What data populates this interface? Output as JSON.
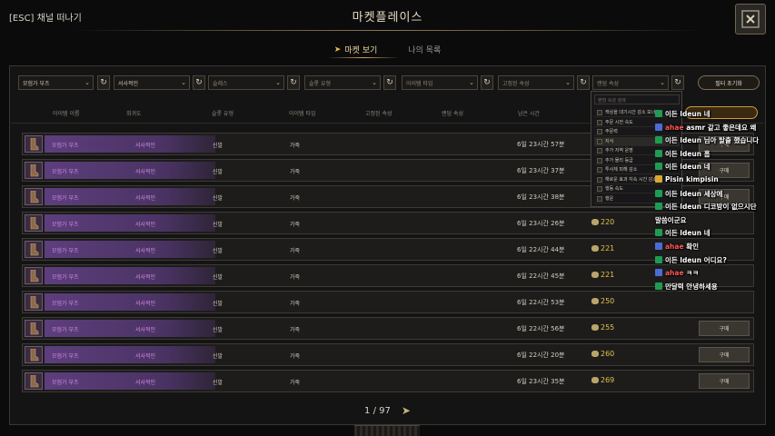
{
  "header": {
    "esc_label": "[ESC] 채널 떠나기",
    "title": "마켓플레이스"
  },
  "tabs": [
    {
      "label": "마켓 보기"
    },
    {
      "label": "나의 목록"
    }
  ],
  "filters": {
    "dropdowns": [
      "모험가 부츠",
      "서사적인",
      "슬레스",
      "슬롯 유형",
      "아이템 타입",
      "고정된 속성",
      "랜덤 속성"
    ],
    "reset_label": "필터 초기화"
  },
  "columns": [
    "아이템 이름",
    "희귀도",
    "슬롯 유형",
    "아이템 타입",
    "고정된 속성",
    "랜덤 속성",
    "남은 시간"
  ],
  "rows": [
    {
      "name": "모험가 부츠",
      "grade": "서사적인",
      "slot": "신발",
      "material": "가죽",
      "time": "6일 23시간 57분",
      "price": "",
      "buy": "구매"
    },
    {
      "name": "모험가 부츠",
      "grade": "서사적인",
      "slot": "신발",
      "material": "가죽",
      "time": "6일 23시간 37분",
      "price": "",
      "buy": "구매"
    },
    {
      "name": "모험가 부츠",
      "grade": "서사적인",
      "slot": "신발",
      "material": "가죽",
      "time": "6일 23시간 38분",
      "price": "",
      "buy": "구매"
    },
    {
      "name": "모험가 부츠",
      "grade": "서사적인",
      "slot": "신발",
      "material": "가죽",
      "time": "6일 23시간 26분",
      "price": "220",
      "buy": ""
    },
    {
      "name": "모험가 부츠",
      "grade": "서사적인",
      "slot": "신발",
      "material": "가죽",
      "time": "6일 22시간 44분",
      "price": "221",
      "buy": ""
    },
    {
      "name": "모험가 부츠",
      "grade": "서사적인",
      "slot": "신발",
      "material": "가죽",
      "time": "6일 22시간 45분",
      "price": "221",
      "buy": ""
    },
    {
      "name": "모험가 부츠",
      "grade": "서사적인",
      "slot": "신발",
      "material": "가죽",
      "time": "6일 22시간 53분",
      "price": "250",
      "buy": ""
    },
    {
      "name": "모험가 부츠",
      "grade": "서사적인",
      "slot": "신발",
      "material": "가죽",
      "time": "6일 22시간 56분",
      "price": "255",
      "buy": "구매"
    },
    {
      "name": "모험가 부츠",
      "grade": "서사적인",
      "slot": "신발",
      "material": "가죽",
      "time": "6일 22시간 20분",
      "price": "260",
      "buy": "구매"
    },
    {
      "name": "모험가 부츠",
      "grade": "서사적인",
      "slot": "신발",
      "material": "가죽",
      "time": "6일 23시간 35분",
      "price": "269",
      "buy": "구매"
    }
  ],
  "attr_popup": {
    "search_placeholder": "랜덤 속성 검색",
    "options": [
      "캐싱을 대기시간 감소 보너스",
      "주문 시전 속도",
      "주문력",
      "지식",
      "추가 지역 운명",
      "추가 물리 등급",
      "투사체 피해 감소",
      "해로운 효과 지속 시간 감소",
      "행동 속도",
      "행운"
    ]
  },
  "chat": [
    {
      "badge": "green",
      "user": "이든 ldeun",
      "msg": "네"
    },
    {
      "badge": "blue",
      "user": "ahae",
      "user_color": "red",
      "msg": "asmr 같고 좋은데요 왜"
    },
    {
      "badge": "green",
      "user": "이든 ldeun",
      "msg": "님아 탈출 했습니다"
    },
    {
      "badge": "green",
      "user": "이든 ldeun",
      "msg": "흠"
    },
    {
      "badge": "green",
      "user": "이든 ldeun",
      "msg": "네"
    },
    {
      "badge": "yellow",
      "user": "Pisin",
      "msg": "kimpisin"
    },
    {
      "badge": "green",
      "user": "이든 ldeun",
      "msg": "세상에"
    },
    {
      "badge": "green",
      "user": "이든 ldeun",
      "msg": "디코방이 없으시단"
    },
    {
      "badge": "",
      "user": "",
      "msg": "말씀이군요"
    },
    {
      "badge": "green",
      "user": "이든 ldeun",
      "msg": "네"
    },
    {
      "badge": "blue",
      "user": "ahae",
      "user_color": "red",
      "msg": "확인"
    },
    {
      "badge": "green",
      "user": "이든 ldeun",
      "msg": "어디요?"
    },
    {
      "badge": "blue",
      "user": "ahae",
      "user_color": "red",
      "msg": "ㅋㅋ"
    },
    {
      "badge": "green",
      "user": "",
      "msg": "만달력 안녕하세용"
    }
  ],
  "pagination": {
    "text": "1 / 97"
  },
  "colors": {
    "accent_gold": "#e8b84a",
    "epic_purple": "#d38ae8",
    "price_gold": "#e3c14c"
  }
}
